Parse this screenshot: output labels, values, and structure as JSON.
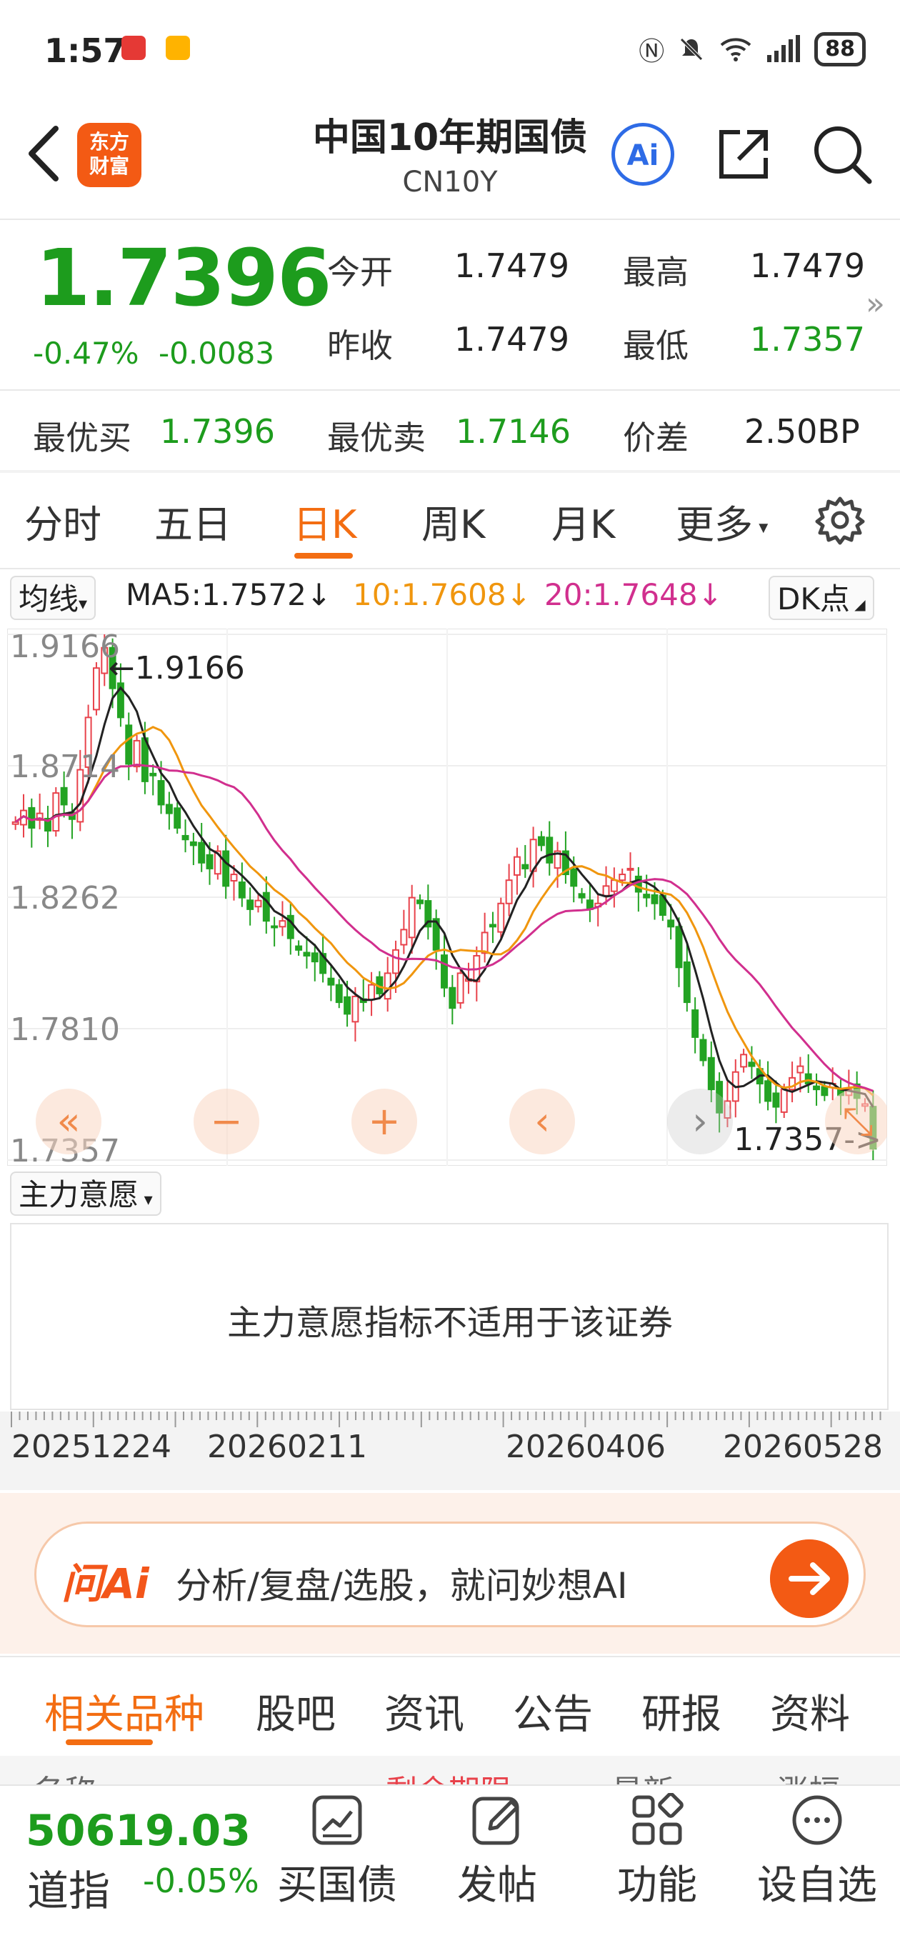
{
  "status_bar": {
    "time": "1:57",
    "battery": "88"
  },
  "header": {
    "back_icon": "chevron-left-icon",
    "logo_line1": "东方",
    "logo_line2": "财富",
    "title": "中国10年期国债",
    "subtitle": "CN10Y",
    "ai_label": "Ai"
  },
  "quote": {
    "price": "1.7396",
    "change_pct": "-0.47%",
    "change_abs": "-0.0083",
    "open_label": "今开",
    "open": "1.7479",
    "high_label": "最高",
    "high": "1.7479",
    "prev_close_label": "昨收",
    "prev_close": "1.7479",
    "low_label": "最低",
    "low": "1.7357",
    "best_bid_label": "最优买",
    "best_bid": "1.7396",
    "best_ask_label": "最优卖",
    "best_ask": "1.7146",
    "spread_label": "价差",
    "spread": "2.50BP",
    "more_arrow": "»"
  },
  "ktabs": {
    "intraday": "分时",
    "five_day": "五日",
    "day_k": "日K",
    "week_k": "周K",
    "month_k": "月K",
    "more": "更多"
  },
  "ma_row": {
    "selector": "均线",
    "ma5": "MA5:1.7572↓",
    "ma10": "10:1.7608↓",
    "ma20": "20:1.7648↓",
    "dk": "DK点"
  },
  "chart_data": {
    "type": "candlestick",
    "y_axis_labels": [
      "1.9166",
      "1.8714",
      "1.8262",
      "1.7810",
      "1.7357"
    ],
    "ylim": [
      1.7357,
      1.9166
    ],
    "max_marker": "←1.9166",
    "min_marker": "1.7357->",
    "series_colors": {
      "up": "#e8424b",
      "down": "#23a323",
      "ma5": "#222222",
      "ma10": "#f0960e",
      "ma20": "#d12f8e"
    },
    "x_labels": [
      "20251224",
      "20260211",
      "20260406",
      "20260528"
    ],
    "closes": [
      1.852,
      1.856,
      1.85,
      1.855,
      1.849,
      1.862,
      1.858,
      1.853,
      1.87,
      1.888,
      1.905,
      1.912,
      1.898,
      1.888,
      1.872,
      1.88,
      1.866,
      1.868,
      1.858,
      1.855,
      1.85,
      1.846,
      1.844,
      1.838,
      1.836,
      1.842,
      1.83,
      1.834,
      1.826,
      1.822,
      1.825,
      1.818,
      1.816,
      1.818,
      1.812,
      1.808,
      1.806,
      1.804,
      1.8,
      1.796,
      1.79,
      1.786,
      1.792,
      1.79,
      1.796,
      1.793,
      1.8,
      1.808,
      1.815,
      1.826,
      1.824,
      1.816,
      1.808,
      1.795,
      1.788,
      1.8,
      1.798,
      1.806,
      1.814,
      1.816,
      1.824,
      1.832,
      1.84,
      1.836,
      1.846,
      1.844,
      1.838,
      1.842,
      1.834,
      1.83,
      1.826,
      1.822,
      1.824,
      1.83,
      1.832,
      1.834,
      1.836,
      1.828,
      1.826,
      1.824,
      1.82,
      1.816,
      1.802,
      1.79,
      1.778,
      1.77,
      1.76,
      1.752,
      1.756,
      1.766,
      1.772,
      1.768,
      1.762,
      1.756,
      1.754,
      1.76,
      1.764,
      1.768,
      1.762,
      1.76,
      1.758,
      1.762,
      1.758,
      1.76,
      1.757,
      1.755,
      1.7396
    ],
    "ma5_last": 1.7572,
    "ma10_last": 1.7608,
    "ma20_last": 1.7648,
    "nav_icons": [
      "double-left-icon",
      "zoom-out-icon",
      "zoom-in-icon",
      "left-icon",
      "right-icon",
      "fullscreen-icon"
    ]
  },
  "indicator": {
    "selector": "主力意愿",
    "message": "主力意愿指标不适用于该证券"
  },
  "ai_bar": {
    "logo": "问Ai",
    "text": "分析/复盘/选股，就问妙想AI"
  },
  "bottom_tabs": {
    "related": "相关品种",
    "forum": "股吧",
    "news": "资讯",
    "notice": "公告",
    "research": "研报",
    "info": "资料"
  },
  "list_header": {
    "col1": "名称",
    "col2": "剩余期限",
    "col3": "最新",
    "col4": "涨幅"
  },
  "bottom_bar": {
    "index_value": "50619.03",
    "index_name": "道指",
    "index_change": "-0.05%",
    "buy": "买国债",
    "post": "发帖",
    "func": "功能",
    "watch": "设自选"
  }
}
